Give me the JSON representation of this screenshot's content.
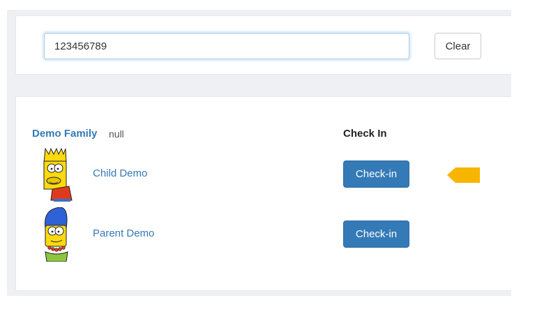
{
  "search": {
    "value": "123456789",
    "clear_label": "Clear"
  },
  "family": {
    "name": "Demo Family",
    "note": "null",
    "checkin_header": "Check In",
    "members": [
      {
        "name": "Child Demo",
        "button_label": "Check-in",
        "avatar_icon": "bart-avatar-icon"
      },
      {
        "name": "Parent Demo",
        "button_label": "Check-in",
        "avatar_icon": "marge-avatar-icon"
      }
    ]
  },
  "colors": {
    "accent": "#337ab7",
    "arrow": "#f7b500"
  },
  "icons": {
    "arrow": "arrow-left-indicator-icon"
  }
}
